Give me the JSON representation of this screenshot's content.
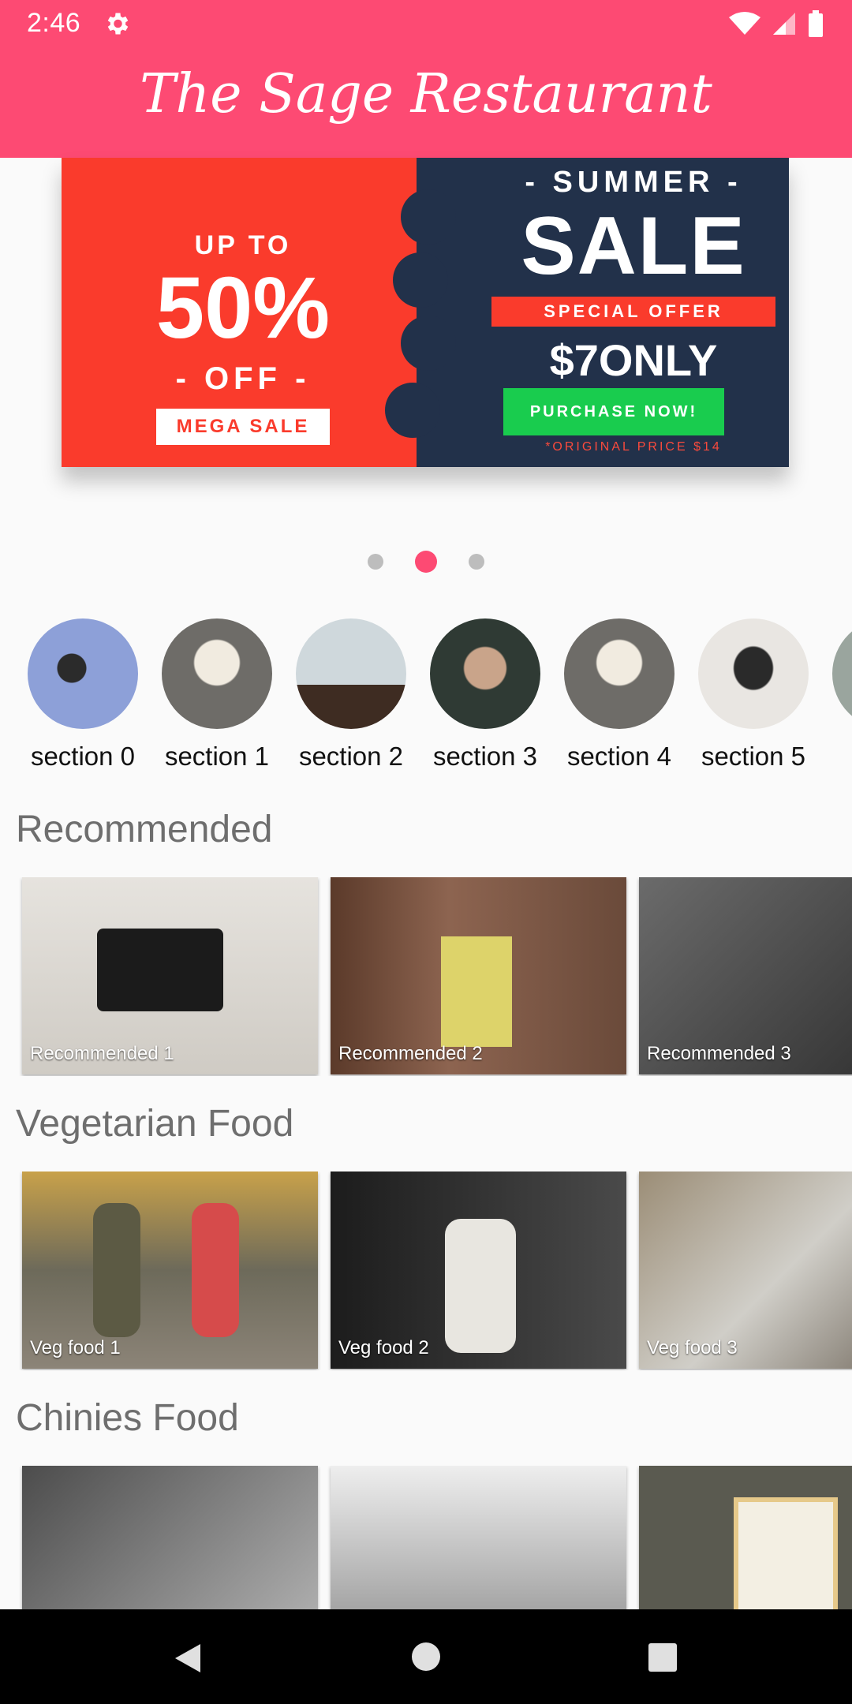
{
  "status": {
    "time": "2:46"
  },
  "app": {
    "title": "The Sage Restaurant"
  },
  "banner": {
    "upto": "UP TO",
    "percent": "50%",
    "off": "- OFF -",
    "mega": "MEGA SALE",
    "summer": "- SUMMER -",
    "sale": "SALE",
    "special": "SPECIAL OFFER",
    "price": "$7ONLY",
    "purchase": "PURCHASE NOW!",
    "original": "*ORIGINAL PRICE $14"
  },
  "carousel": {
    "pages": 3,
    "active_page": 2
  },
  "sections": [
    "section 0",
    "section 1",
    "section 2",
    "section 3",
    "section 4",
    "section 5",
    "s"
  ],
  "categories": [
    {
      "title": "Recommended",
      "items": [
        "Recommended 1",
        "Recommended 2",
        "Recommended 3"
      ]
    },
    {
      "title": "Vegetarian Food",
      "items": [
        "Veg food 1",
        "Veg food 2",
        "Veg food 3"
      ]
    },
    {
      "title": "Chinies Food",
      "items": [
        "",
        "",
        ""
      ]
    }
  ],
  "colors": {
    "primary": "#fd4a73",
    "banner_red": "#fa3b2c",
    "banner_navy": "#22314a",
    "buy_green": "#19cc4e"
  }
}
